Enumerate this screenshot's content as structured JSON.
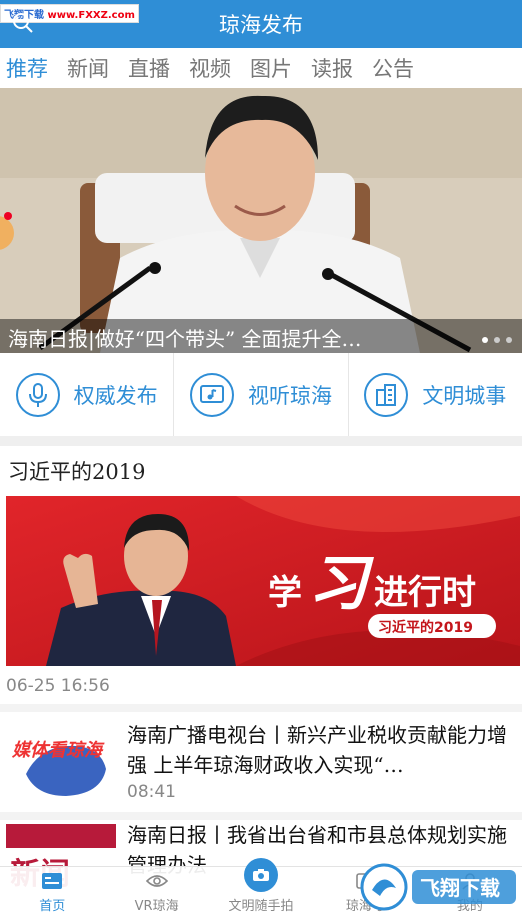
{
  "watermark": {
    "prefix": "飞翔下载",
    "url": "www.FXXZ.com"
  },
  "header": {
    "title": "琼海发布"
  },
  "tabs": [
    "推荐",
    "新闻",
    "直播",
    "视频",
    "图片",
    "读报",
    "公告"
  ],
  "hero": {
    "caption": "海南日报|做好“四个带头” 全面提升全…"
  },
  "quick_entries": [
    {
      "label": "权威发布",
      "icon": "microphone-icon"
    },
    {
      "label": "视听琼海",
      "icon": "music-screen-icon"
    },
    {
      "label": "文明城事",
      "icon": "building-icon"
    }
  ],
  "feature": {
    "title": "习近平的2019",
    "banner_text_1": "学",
    "banner_text_2": "习",
    "banner_text_3": "进行时",
    "banner_badge": "习近平的2019",
    "time": "06-25  16:56"
  },
  "news": [
    {
      "headline": "海南广播电视台丨新兴产业税收贡献能力增强 上半年琼海财政收入实现“…",
      "time": "08:41",
      "thumb_text": "媒体看琼海"
    },
    {
      "headline": "海南日报丨我省出台省和市县总体规划实施管理办法",
      "time": "",
      "thumb_text": "新闻"
    }
  ],
  "bottom_nav": [
    {
      "label": "首页",
      "icon": "home-card-icon",
      "active": true
    },
    {
      "label": "VR琼海",
      "icon": "eye-icon",
      "active": false
    },
    {
      "label": "文明随手拍",
      "icon": "camera-icon",
      "active": false
    },
    {
      "label": "琼海号",
      "icon": "account-icon",
      "active": false
    },
    {
      "label": "我的",
      "icon": "user-icon",
      "active": false
    }
  ],
  "logo_overlay": "飞翔下载",
  "colors": {
    "primary": "#2f8ed6",
    "banner_red": "#d71920"
  }
}
